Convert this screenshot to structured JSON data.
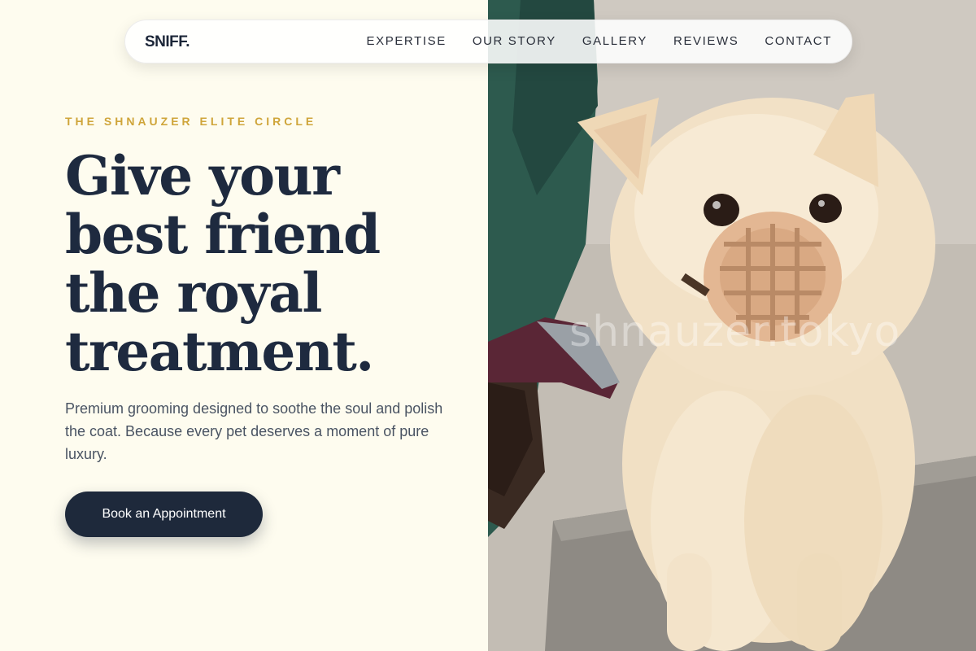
{
  "nav": {
    "brand": "SNIFF.",
    "links": [
      {
        "label": "EXPERTISE"
      },
      {
        "label": "OUR STORY"
      },
      {
        "label": "GALLERY"
      },
      {
        "label": "REVIEWS"
      },
      {
        "label": "CONTACT"
      }
    ]
  },
  "hero": {
    "eyebrow": "THE SHNAUZER ELITE CIRCLE",
    "headline_lines": [
      "Give your",
      "best friend",
      "the royal",
      "treatment."
    ],
    "subtext": "Premium grooming designed to soothe the soul and polish the coat. Because every pet deserves a moment of pure luxury.",
    "cta_label": "Book an Appointment"
  },
  "photo": {
    "subject": "fluffy cream pomeranian wearing a muzzle on a grooming table",
    "watermark": "shnauzer.tokyo"
  },
  "colors": {
    "background": "#fefcef",
    "accent": "#cfa53a",
    "heading": "#1e2a3f",
    "button": "#1e293b",
    "body_text": "#4a5463"
  }
}
